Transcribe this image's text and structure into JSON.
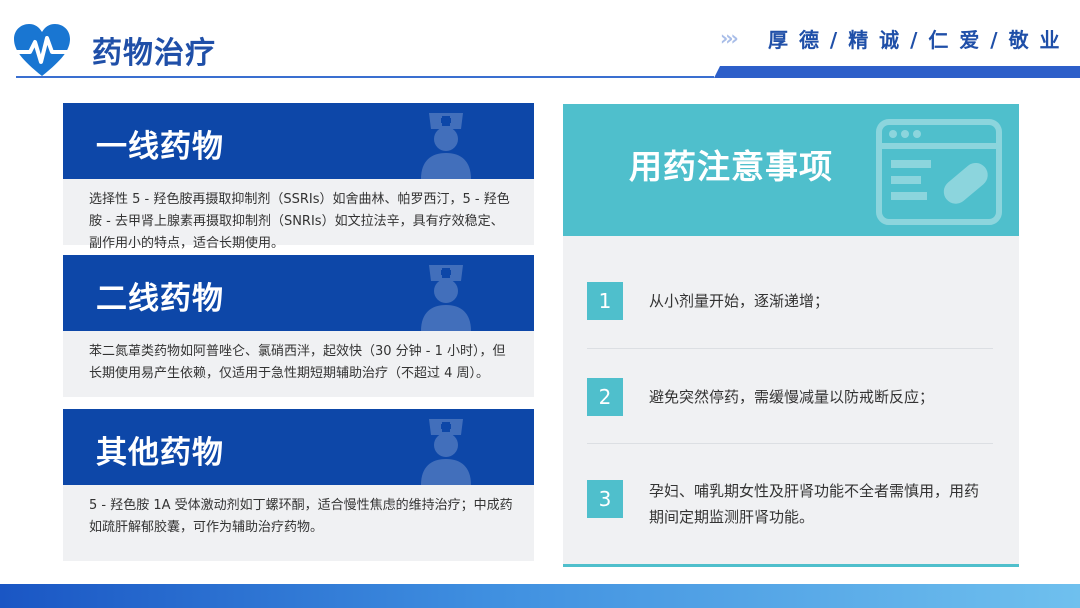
{
  "header": {
    "title": "药物治疗",
    "slogan": "厚 德 / 精 诚 / 仁 爱 / 敬 业",
    "chevrons": "›››"
  },
  "cards": [
    {
      "title": "一线药物",
      "body": "选择性 5 - 羟色胺再摄取抑制剂（SSRIs）如舍曲林、帕罗西汀，5 - 羟色胺 - 去甲肾上腺素再摄取抑制剂（SNRIs）如文拉法辛，具有疗效稳定、副作用小的特点，适合长期使用。"
    },
    {
      "title": "二线药物",
      "body": "苯二氮䓬类药物如阿普唑仑、氯硝西泮，起效快（30 分钟 - 1 小时），但长期使用易产生依赖，仅适用于急性期短期辅助治疗（不超过 4 周）。"
    },
    {
      "title": "其他药物",
      "body": "5 - 羟色胺 1A 受体激动剂如丁螺环酮，适合慢性焦虑的维持治疗；中成药如疏肝解郁胶囊，可作为辅助治疗药物。"
    }
  ],
  "panel": {
    "title": "用药注意事项",
    "items": [
      {
        "num": "1",
        "text": "从小剂量开始，逐渐递增；"
      },
      {
        "num": "2",
        "text": "避免突然停药，需缓慢减量以防戒断反应；"
      },
      {
        "num": "3",
        "text": "孕妇、哺乳期女性及肝肾功能不全者需慎用，用药期间定期监测肝肾功能。"
      }
    ]
  },
  "colors": {
    "primary": "#0d47a8",
    "teal": "#4fbfcc",
    "card_bg": "#f0f1f3"
  }
}
